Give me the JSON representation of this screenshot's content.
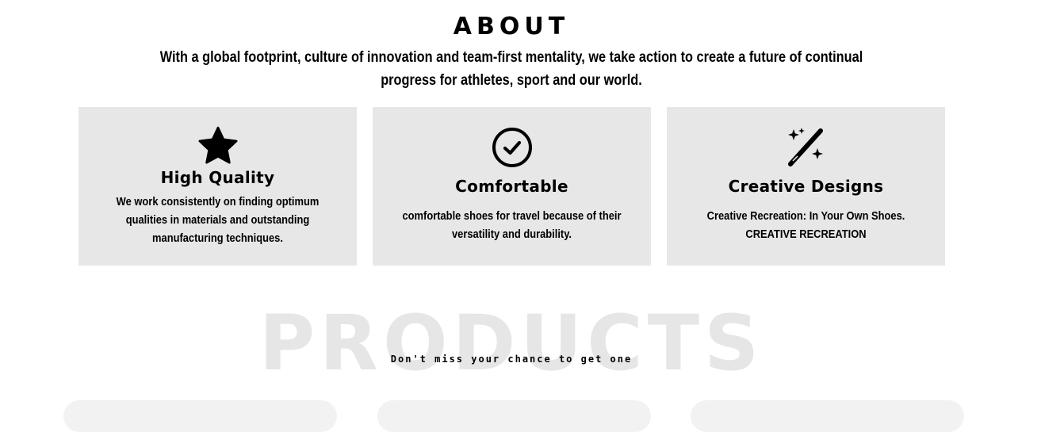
{
  "about": {
    "title": "ABOUT",
    "text": "With a global footprint, culture of innovation and team-first mentality, we take action to create a future of continual progress for athletes, sport and our world."
  },
  "features": [
    {
      "icon": "star-icon",
      "title": "High Quality",
      "text": "We work consistently on finding optimum qualities in materials and outstanding manufacturing techniques."
    },
    {
      "icon": "check-circle-icon",
      "title": "Comfortable",
      "text": "comfortable shoes for travel because of their versatility and durability."
    },
    {
      "icon": "magic-wand-icon",
      "title": "Creative Designs",
      "text": "Creative Recreation: In Your Own Shoes. CREATIVE RECREATION"
    }
  ],
  "products": {
    "heading": "PRODUCTS",
    "subtitle": "Don't miss your chance to get one"
  }
}
